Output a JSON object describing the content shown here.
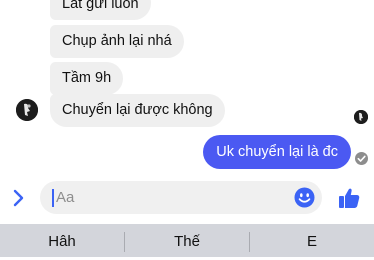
{
  "chat": {
    "messages_received": [
      "Lát gửi luôn",
      "Chụp ảnh lại nhá",
      "Tầm 9h",
      "Chuyển lại được không"
    ],
    "message_sent": "Uk chuyển lại là đc"
  },
  "composer": {
    "placeholder": "Aa",
    "icons": {
      "expand": "chevron-right-icon",
      "emoji": "smiley-icon",
      "like": "thumbs-up-icon"
    }
  },
  "keyboard": {
    "suggestions": [
      "Hâh",
      "Thế",
      "E"
    ]
  },
  "colors": {
    "accent": "#4b59f2",
    "received_bubble": "#efefef",
    "keyboard_bg": "#d3d5db"
  }
}
